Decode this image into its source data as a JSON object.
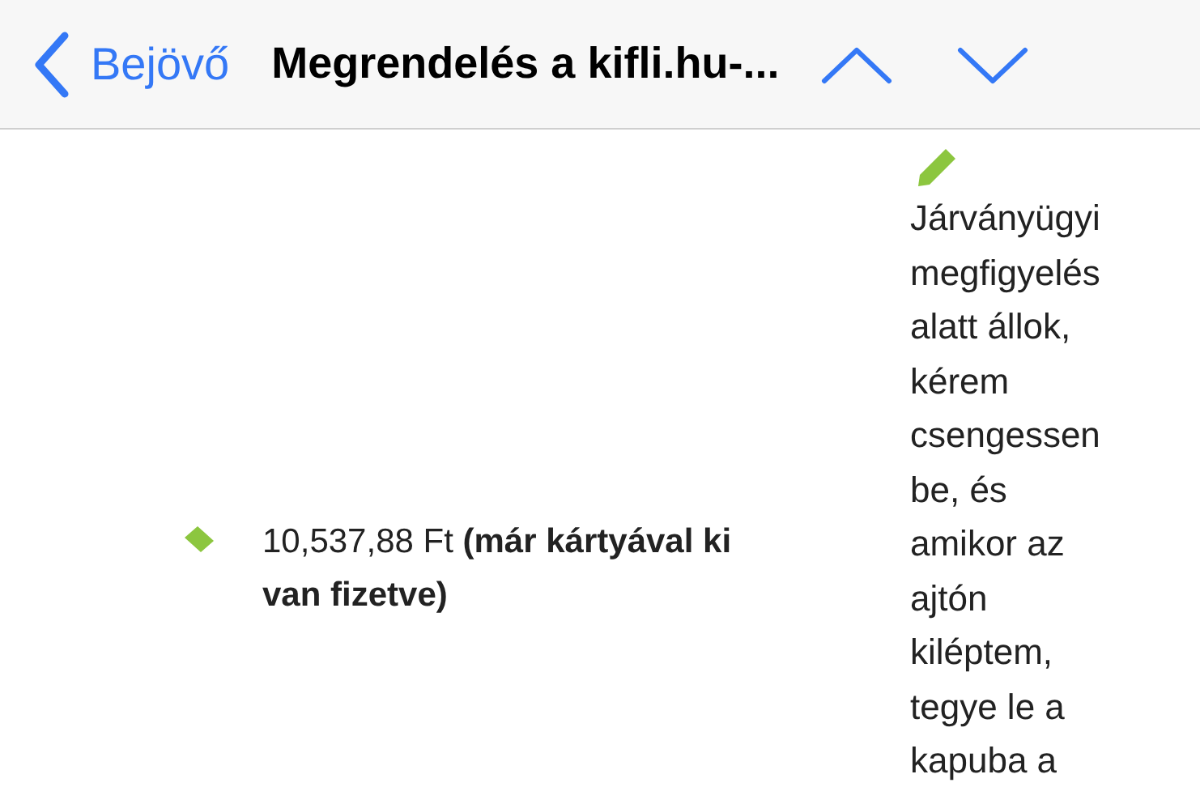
{
  "nav_bar": {
    "back_label": "Bejövő",
    "title": "Megrendelés a kifli.hu-..."
  },
  "payment": {
    "text": "10,537,88 Ft **(már kártyával ki van fizetve)**"
  },
  "note": {
    "text": "Járványügyi megfigyelés alatt állok, kérem csengessen be, és amikor az ajtón kiléptem, tegye le a kapuba a"
  }
}
